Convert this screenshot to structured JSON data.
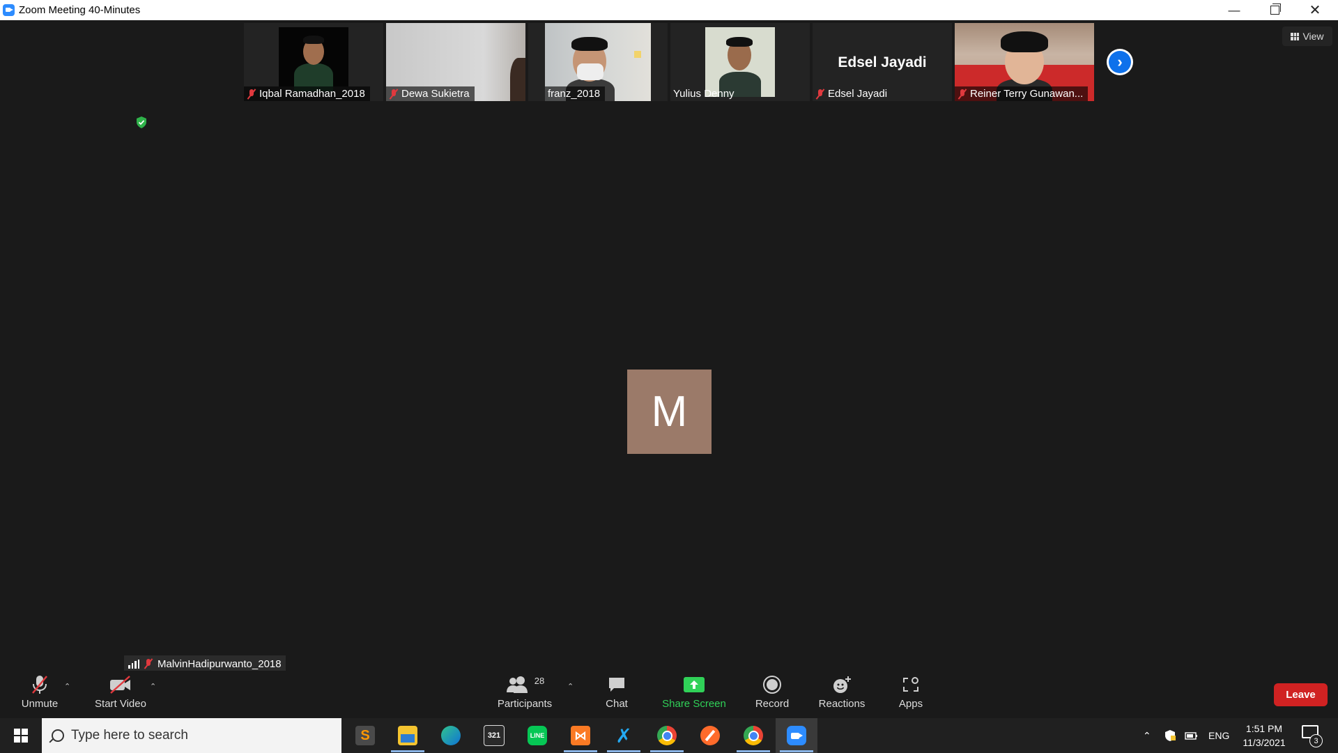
{
  "window": {
    "title": "Zoom Meeting 40-Minutes"
  },
  "participants_strip": [
    {
      "name": "Iqbal Ramadhan_2018",
      "muted": true
    },
    {
      "name": "Dewa Sukietra",
      "muted": true
    },
    {
      "name": "franz_2018",
      "muted": false
    },
    {
      "name": "Yulius Denny",
      "muted": false
    },
    {
      "name": "Edsel Jayadi",
      "muted": true,
      "video_off_label": "Edsel Jayadi"
    },
    {
      "name": "Reiner Terry Gunawan...",
      "muted": true
    }
  ],
  "view_button": {
    "label": "View"
  },
  "active_speaker": {
    "initial": "M",
    "name": "MalvinHadipurwanto_2018",
    "avatar_color": "#9b7a69"
  },
  "controls": {
    "unmute": "Unmute",
    "start_video": "Start Video",
    "participants": "Participants",
    "participant_count": "28",
    "chat": "Chat",
    "share_screen": "Share Screen",
    "record": "Record",
    "reactions": "Reactions",
    "apps": "Apps",
    "leave": "Leave"
  },
  "taskbar": {
    "search_placeholder": "Type here to search",
    "language": "ENG",
    "time": "1:51 PM",
    "date": "11/3/2021",
    "notification_count": "3"
  },
  "colors": {
    "accent": "#0e71eb",
    "leave": "#d02222",
    "share": "#30d158",
    "muted": "#e0393e"
  }
}
